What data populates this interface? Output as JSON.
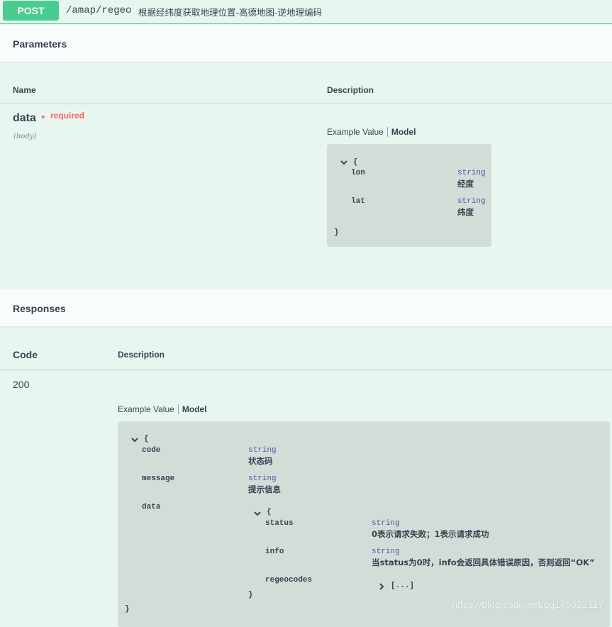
{
  "operation": {
    "method": "POST",
    "path": "/amap/regeo",
    "summary": "根据经纬度获取地理位置-高德地图-逆地理编码"
  },
  "parameters": {
    "title": "Parameters",
    "col_name": "Name",
    "col_description": "Description",
    "param": {
      "name": "data",
      "required_star": "*",
      "required_label": "required",
      "in": "(body)"
    },
    "tabs": {
      "example": "Example Value",
      "model": "Model"
    },
    "model": {
      "open_brace": "{",
      "close_brace": "}",
      "fields": [
        {
          "name": "lon",
          "type": "string",
          "desc": "经度"
        },
        {
          "name": "lat",
          "type": "string",
          "desc": "纬度"
        }
      ]
    }
  },
  "responses": {
    "title": "Responses",
    "col_code": "Code",
    "col_description": "Description",
    "code": "200",
    "tabs": {
      "example": "Example Value",
      "model": "Model"
    },
    "model": {
      "open_brace": "{",
      "close_brace": "}",
      "fields": [
        {
          "name": "code",
          "type": "string",
          "desc": "状态码"
        },
        {
          "name": "message",
          "type": "string",
          "desc": "提示信息"
        }
      ],
      "data": {
        "name": "data",
        "open_brace": "{",
        "close_brace": "}",
        "fields": [
          {
            "name": "status",
            "type": "string",
            "desc": "0表示请求失败；1表示请求成功"
          },
          {
            "name": "info",
            "type": "string",
            "desc": "当status为0时，info会返回具体错误原因，否则返回“OK”"
          }
        ],
        "regeocodes": {
          "name": "regeocodes",
          "collapsed": "[...]"
        }
      }
    }
  },
  "watermark": "https://blog.csdn.net/qq175023117"
}
